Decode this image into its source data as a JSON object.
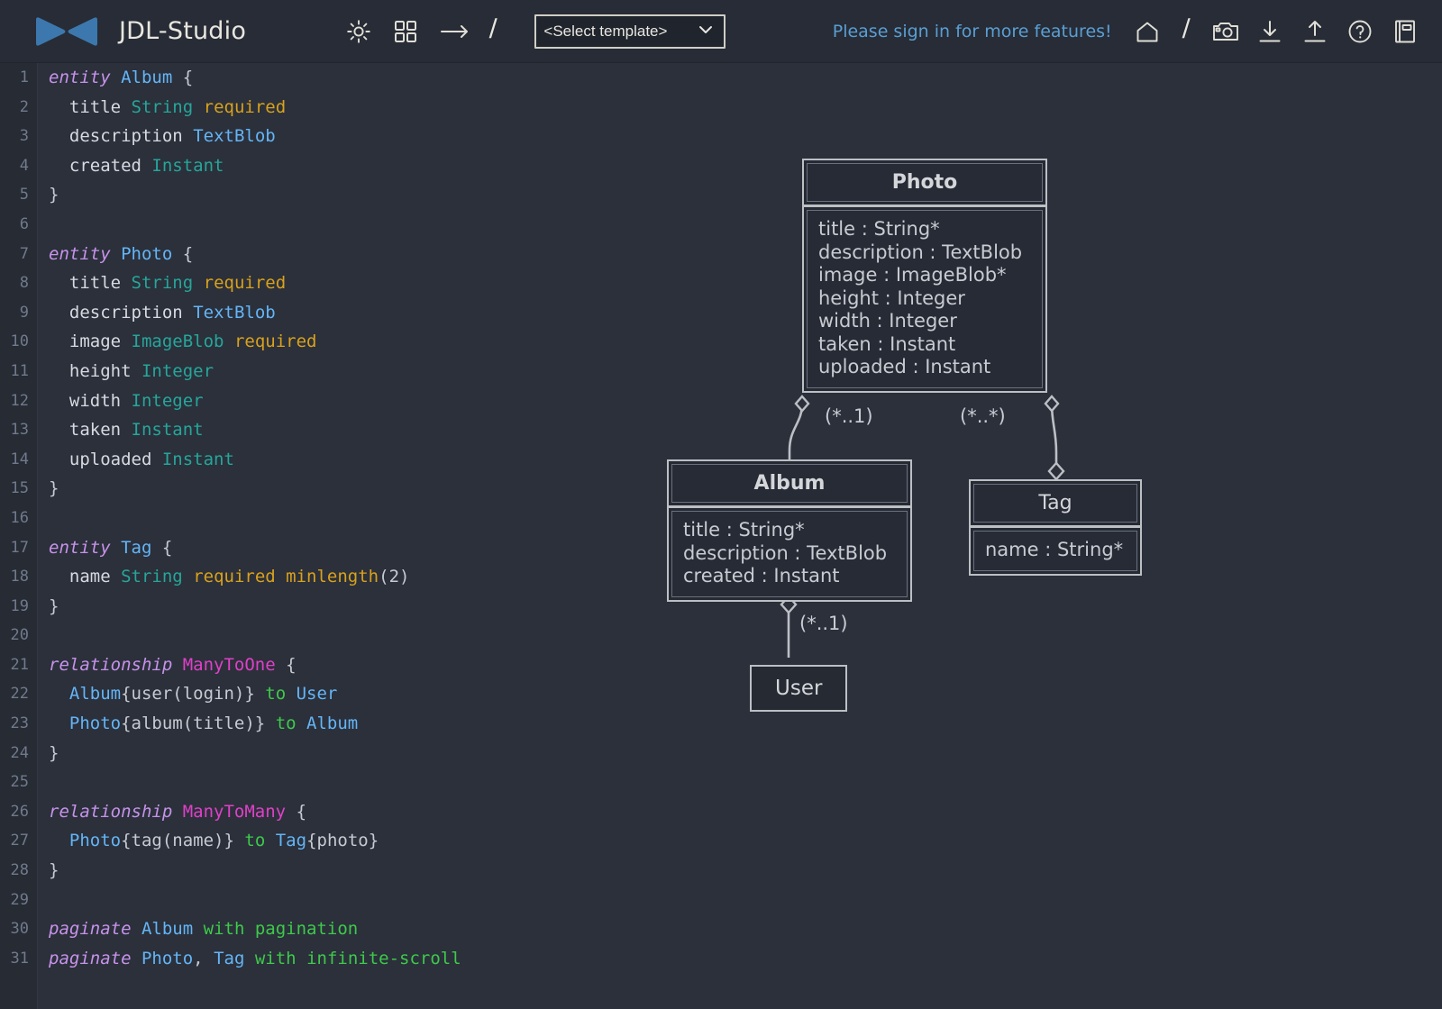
{
  "app": {
    "title": "JDL-Studio",
    "logo_color": "#3c78ad"
  },
  "header": {
    "tools": [
      {
        "name": "brightness-icon",
        "label": "brightness"
      },
      {
        "name": "grid-icon",
        "label": "grid"
      },
      {
        "name": "arrow-right-icon",
        "label": "arrow"
      }
    ],
    "separator": "/",
    "template_select": {
      "value": "<Select template>",
      "caret": "⌄"
    },
    "signin_text": "Please sign in for more features!",
    "right_icons": [
      {
        "name": "home-icon",
        "label": "home"
      },
      {
        "name": "separator-slash",
        "label": "/"
      },
      {
        "name": "camera-icon",
        "label": "camera"
      },
      {
        "name": "download-icon",
        "label": "download"
      },
      {
        "name": "upload-icon",
        "label": "upload"
      },
      {
        "name": "help-circle-icon",
        "label": "help"
      },
      {
        "name": "book-icon",
        "label": "documentation"
      }
    ]
  },
  "editor": {
    "lines": [
      {
        "n": 1,
        "tokens": [
          {
            "t": "kw",
            "s": "entity"
          },
          {
            "t": "sp",
            "s": " "
          },
          {
            "t": "ent",
            "s": "Album"
          },
          {
            "t": "sp",
            "s": " "
          },
          {
            "t": "pun",
            "s": "{"
          }
        ]
      },
      {
        "n": 2,
        "tokens": [
          {
            "t": "sp",
            "s": "  "
          },
          {
            "t": "fld",
            "s": "title"
          },
          {
            "t": "sp",
            "s": " "
          },
          {
            "t": "type",
            "s": "String"
          },
          {
            "t": "sp",
            "s": " "
          },
          {
            "t": "req",
            "s": "required"
          }
        ]
      },
      {
        "n": 3,
        "tokens": [
          {
            "t": "sp",
            "s": "  "
          },
          {
            "t": "fld",
            "s": "description"
          },
          {
            "t": "sp",
            "s": " "
          },
          {
            "t": "blob",
            "s": "TextBlob"
          }
        ]
      },
      {
        "n": 4,
        "tokens": [
          {
            "t": "sp",
            "s": "  "
          },
          {
            "t": "fld",
            "s": "created"
          },
          {
            "t": "sp",
            "s": " "
          },
          {
            "t": "type",
            "s": "Instant"
          }
        ]
      },
      {
        "n": 5,
        "tokens": [
          {
            "t": "pun",
            "s": "}"
          }
        ]
      },
      {
        "n": 6,
        "tokens": []
      },
      {
        "n": 7,
        "tokens": [
          {
            "t": "kw",
            "s": "entity"
          },
          {
            "t": "sp",
            "s": " "
          },
          {
            "t": "ent",
            "s": "Photo"
          },
          {
            "t": "sp",
            "s": " "
          },
          {
            "t": "pun",
            "s": "{"
          }
        ]
      },
      {
        "n": 8,
        "tokens": [
          {
            "t": "sp",
            "s": "  "
          },
          {
            "t": "fld",
            "s": "title"
          },
          {
            "t": "sp",
            "s": " "
          },
          {
            "t": "type",
            "s": "String"
          },
          {
            "t": "sp",
            "s": " "
          },
          {
            "t": "req",
            "s": "required"
          }
        ]
      },
      {
        "n": 9,
        "tokens": [
          {
            "t": "sp",
            "s": "  "
          },
          {
            "t": "fld",
            "s": "description"
          },
          {
            "t": "sp",
            "s": " "
          },
          {
            "t": "blob",
            "s": "TextBlob"
          }
        ]
      },
      {
        "n": 10,
        "tokens": [
          {
            "t": "sp",
            "s": "  "
          },
          {
            "t": "fld",
            "s": "image"
          },
          {
            "t": "sp",
            "s": " "
          },
          {
            "t": "type",
            "s": "ImageBlob"
          },
          {
            "t": "sp",
            "s": " "
          },
          {
            "t": "req",
            "s": "required"
          }
        ]
      },
      {
        "n": 11,
        "tokens": [
          {
            "t": "sp",
            "s": "  "
          },
          {
            "t": "fld",
            "s": "height"
          },
          {
            "t": "sp",
            "s": " "
          },
          {
            "t": "type",
            "s": "Integer"
          }
        ]
      },
      {
        "n": 12,
        "tokens": [
          {
            "t": "sp",
            "s": "  "
          },
          {
            "t": "fld",
            "s": "width"
          },
          {
            "t": "sp",
            "s": " "
          },
          {
            "t": "type",
            "s": "Integer"
          }
        ]
      },
      {
        "n": 13,
        "tokens": [
          {
            "t": "sp",
            "s": "  "
          },
          {
            "t": "fld",
            "s": "taken"
          },
          {
            "t": "sp",
            "s": " "
          },
          {
            "t": "type",
            "s": "Instant"
          }
        ]
      },
      {
        "n": 14,
        "tokens": [
          {
            "t": "sp",
            "s": "  "
          },
          {
            "t": "fld",
            "s": "uploaded"
          },
          {
            "t": "sp",
            "s": " "
          },
          {
            "t": "type",
            "s": "Instant"
          }
        ]
      },
      {
        "n": 15,
        "tokens": [
          {
            "t": "pun",
            "s": "}"
          }
        ]
      },
      {
        "n": 16,
        "tokens": []
      },
      {
        "n": 17,
        "tokens": [
          {
            "t": "kw",
            "s": "entity"
          },
          {
            "t": "sp",
            "s": " "
          },
          {
            "t": "ent",
            "s": "Tag"
          },
          {
            "t": "sp",
            "s": " "
          },
          {
            "t": "pun",
            "s": "{"
          }
        ]
      },
      {
        "n": 18,
        "tokens": [
          {
            "t": "sp",
            "s": "  "
          },
          {
            "t": "fld",
            "s": "name"
          },
          {
            "t": "sp",
            "s": " "
          },
          {
            "t": "type",
            "s": "String"
          },
          {
            "t": "sp",
            "s": " "
          },
          {
            "t": "req",
            "s": "required"
          },
          {
            "t": "sp",
            "s": " "
          },
          {
            "t": "req",
            "s": "minlength"
          },
          {
            "t": "pun",
            "s": "(2)"
          }
        ]
      },
      {
        "n": 19,
        "tokens": [
          {
            "t": "pun",
            "s": "}"
          }
        ]
      },
      {
        "n": 20,
        "tokens": []
      },
      {
        "n": 21,
        "tokens": [
          {
            "t": "kw",
            "s": "relationship"
          },
          {
            "t": "sp",
            "s": " "
          },
          {
            "t": "rel",
            "s": "ManyToOne"
          },
          {
            "t": "sp",
            "s": " "
          },
          {
            "t": "pun",
            "s": "{"
          }
        ]
      },
      {
        "n": 22,
        "tokens": [
          {
            "t": "sp",
            "s": "  "
          },
          {
            "t": "ent",
            "s": "Album"
          },
          {
            "t": "pun",
            "s": "{user(login)}"
          },
          {
            "t": "sp",
            "s": " "
          },
          {
            "t": "to",
            "s": "to"
          },
          {
            "t": "sp",
            "s": " "
          },
          {
            "t": "ent",
            "s": "User"
          }
        ]
      },
      {
        "n": 23,
        "tokens": [
          {
            "t": "sp",
            "s": "  "
          },
          {
            "t": "ent",
            "s": "Photo"
          },
          {
            "t": "pun",
            "s": "{album(title)}"
          },
          {
            "t": "sp",
            "s": " "
          },
          {
            "t": "to",
            "s": "to"
          },
          {
            "t": "sp",
            "s": " "
          },
          {
            "t": "ent",
            "s": "Album"
          }
        ]
      },
      {
        "n": 24,
        "tokens": [
          {
            "t": "pun",
            "s": "}"
          }
        ]
      },
      {
        "n": 25,
        "tokens": []
      },
      {
        "n": 26,
        "tokens": [
          {
            "t": "kw",
            "s": "relationship"
          },
          {
            "t": "sp",
            "s": " "
          },
          {
            "t": "rel",
            "s": "ManyToMany"
          },
          {
            "t": "sp",
            "s": " "
          },
          {
            "t": "pun",
            "s": "{"
          }
        ]
      },
      {
        "n": 27,
        "tokens": [
          {
            "t": "sp",
            "s": "  "
          },
          {
            "t": "ent",
            "s": "Photo"
          },
          {
            "t": "pun",
            "s": "{tag(name)}"
          },
          {
            "t": "sp",
            "s": " "
          },
          {
            "t": "to",
            "s": "to"
          },
          {
            "t": "sp",
            "s": " "
          },
          {
            "t": "ent",
            "s": "Tag"
          },
          {
            "t": "pun",
            "s": "{photo}"
          }
        ]
      },
      {
        "n": 28,
        "tokens": [
          {
            "t": "pun",
            "s": "}"
          }
        ]
      },
      {
        "n": 29,
        "tokens": []
      },
      {
        "n": 30,
        "tokens": [
          {
            "t": "kw",
            "s": "paginate"
          },
          {
            "t": "sp",
            "s": " "
          },
          {
            "t": "ent",
            "s": "Album"
          },
          {
            "t": "sp",
            "s": " "
          },
          {
            "t": "to",
            "s": "with"
          },
          {
            "t": "sp",
            "s": " "
          },
          {
            "t": "to",
            "s": "pagination"
          }
        ]
      },
      {
        "n": 31,
        "tokens": [
          {
            "t": "kw",
            "s": "paginate"
          },
          {
            "t": "sp",
            "s": " "
          },
          {
            "t": "ent",
            "s": "Photo"
          },
          {
            "t": "pun",
            "s": ","
          },
          {
            "t": "sp",
            "s": " "
          },
          {
            "t": "ent",
            "s": "Tag"
          },
          {
            "t": "sp",
            "s": " "
          },
          {
            "t": "to",
            "s": "with"
          },
          {
            "t": "sp",
            "s": " "
          },
          {
            "t": "to",
            "s": "infinite-scroll"
          }
        ]
      }
    ]
  },
  "diagram": {
    "entities": [
      {
        "name": "Photo",
        "fields": "title : String*\ndescription : TextBlob\nimage : ImageBlob*\nheight : Integer\nwidth : Integer\ntaken : Instant\nuploaded : Instant"
      },
      {
        "name": "Album",
        "fields": "title : String*\ndescription : TextBlob\ncreated : Instant"
      },
      {
        "name": "Tag",
        "fields": "name : String*"
      },
      {
        "name": "User",
        "fields": ""
      }
    ],
    "multiplicities": [
      {
        "label": "(*..1)",
        "from": "Photo",
        "to": "Album"
      },
      {
        "label": "(*..*)",
        "from": "Photo",
        "to": "Tag"
      },
      {
        "label": "(*..1)",
        "from": "Album",
        "to": "User"
      }
    ],
    "line_color": "#bcbfc4"
  }
}
